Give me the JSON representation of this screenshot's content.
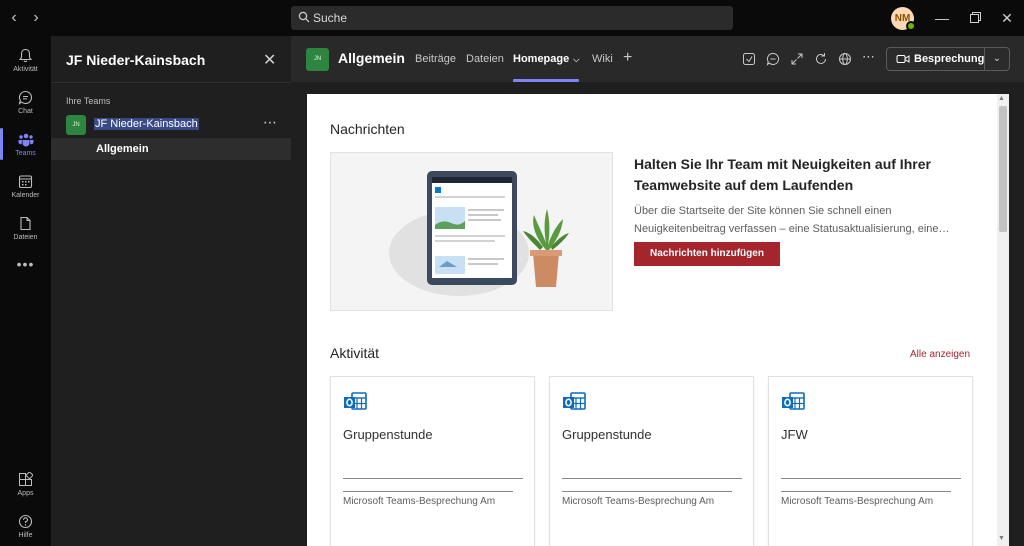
{
  "titlebar": {
    "search_placeholder": "Suche",
    "avatar_initials": "NM"
  },
  "rail": {
    "items": [
      {
        "label": "Aktivität",
        "icon": "bell-icon"
      },
      {
        "label": "Chat",
        "icon": "chat-icon"
      },
      {
        "label": "Teams",
        "icon": "teams-icon",
        "active": true
      },
      {
        "label": "Kalender",
        "icon": "calendar-icon"
      },
      {
        "label": "Dateien",
        "icon": "file-icon"
      }
    ],
    "bottom": [
      {
        "label": "Apps",
        "icon": "apps-icon"
      },
      {
        "label": "Hilfe",
        "icon": "help-icon"
      }
    ]
  },
  "sidebar": {
    "title": "JF Nieder-Kainsbach",
    "section_label": "Ihre Teams",
    "team": {
      "avatar": "JN",
      "name": "JF Nieder-Kainsbach"
    },
    "channel": "Allgemein"
  },
  "channel_header": {
    "avatar": "JN",
    "name": "Allgemein",
    "tabs": [
      "Beiträge",
      "Dateien",
      "Homepage",
      "Wiki"
    ],
    "active_tab": "Homepage",
    "meeting_button": "Besprechung"
  },
  "content": {
    "news_title": "Nachrichten",
    "news_headline": "Halten Sie Ihr Team mit Neuigkeiten auf Ihrer Teamwebsite auf dem Laufenden",
    "news_description": "Über die Startseite der Site können Sie schnell einen Neuigkeitenbeitrag verfassen – eine Statusaktualisierung, eine…",
    "news_button": "Nachrichten hinzufügen",
    "activity_title": "Aktivität",
    "see_all": "Alle anzeigen",
    "activity_cards": [
      {
        "title": "Gruppenstunde",
        "subtitle": "Microsoft Teams-Besprechung Am"
      },
      {
        "title": "Gruppenstunde",
        "subtitle": "Microsoft Teams-Besprechung Am"
      },
      {
        "title": "JFW",
        "subtitle": "Microsoft Teams-Besprechung Am"
      }
    ]
  },
  "colors": {
    "accent": "#7f85f5",
    "brand_red": "#a4262c",
    "team_green": "#2e8540"
  }
}
